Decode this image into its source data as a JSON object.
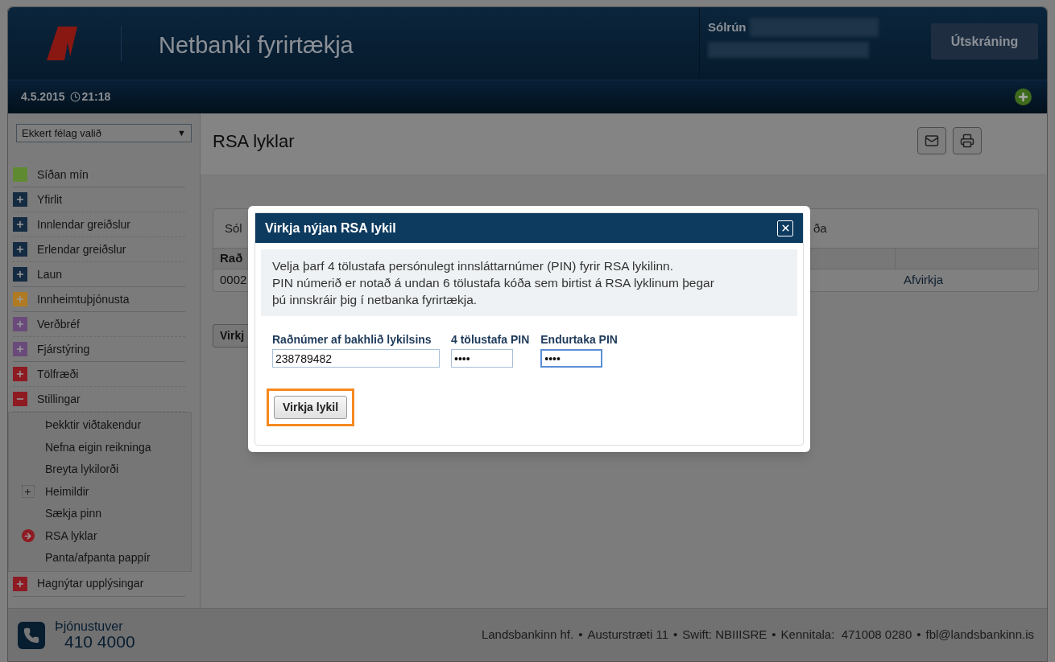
{
  "header": {
    "title": "Netbanki fyrirtækja",
    "user_name": "Sólrún",
    "logout_button": "Útskráning",
    "date": "4.5.2015",
    "time": "21:18"
  },
  "sidebar": {
    "company_select": {
      "value": "Ekkert félag valið",
      "arrow": "▼"
    },
    "items": [
      {
        "label": "Síðan mín",
        "kind": "page",
        "color": "#5f8a32"
      },
      {
        "label": "Yfirlit",
        "kind": "section",
        "color": "#142b42",
        "expanded": false
      },
      {
        "label": "Innlendar greiðslur",
        "kind": "section",
        "color": "#142b42",
        "expanded": false
      },
      {
        "label": "Erlendar greiðslur",
        "kind": "section",
        "color": "#142b42",
        "expanded": false
      },
      {
        "label": "Laun",
        "kind": "section",
        "color": "#142b42",
        "expanded": false
      },
      {
        "label": "Innheimtuþjónusta",
        "kind": "section",
        "color": "#b07a22",
        "expanded": false
      },
      {
        "label": "Verðbréf",
        "kind": "section",
        "color": "#6a4a7a",
        "expanded": false
      },
      {
        "label": "Fjárstýring",
        "kind": "section",
        "color": "#6a4a7a",
        "expanded": false
      },
      {
        "label": "Tölfræði",
        "kind": "section",
        "color": "#8e1a22",
        "expanded": false
      },
      {
        "label": "Stillingar",
        "kind": "section",
        "color": "#8e1a22",
        "expanded": true,
        "children": [
          {
            "label": "Þekktir viðtakendur",
            "kind": "link",
            "selected": false
          },
          {
            "label": "Nefna eigin reikninga",
            "kind": "link",
            "selected": false
          },
          {
            "label": "Breyta lykilorði",
            "kind": "link",
            "selected": false
          },
          {
            "label": "Heimildir",
            "kind": "group",
            "selected": false
          },
          {
            "label": "Sækja pinn",
            "kind": "link",
            "selected": false
          },
          {
            "label": "RSA lyklar",
            "kind": "link",
            "selected": true
          },
          {
            "label": "Panta/afpanta pappír",
            "kind": "link",
            "selected": false
          }
        ]
      },
      {
        "label": "Hagnýtar upplýsingar",
        "kind": "section",
        "color": "#8e1a22",
        "expanded": false
      }
    ]
  },
  "content": {
    "title": "RSA lyklar",
    "table": {
      "title_start": "Sól",
      "title_end": "ða",
      "header_start": "Rað",
      "row_start": "0002",
      "row_action": "Afvirkja"
    },
    "button_start": "Virkj"
  },
  "dialog": {
    "title": "Virkja nýjan RSA lykil",
    "info": [
      "Velja þarf 4 tölustafa persónulegt innsláttarnúmer (PIN) fyrir RSA lykilinn.",
      "PIN númerið er notað á undan 6 tölustafa kóða sem birtist á RSA lyklinum þegar",
      "þú innskráir þig í netbanka fyrirtækja."
    ],
    "fields": [
      {
        "label": "Raðnúmer af bakhlið lykilsins",
        "value": "238789482",
        "focused": false
      },
      {
        "label": "4 tölustafa PIN",
        "value": "••••",
        "focused": false
      },
      {
        "label": "Endurtaka PIN",
        "value": "••••",
        "focused": true
      }
    ],
    "submit_button": {
      "label": "Virkja lykil",
      "highlighted": true
    }
  },
  "footer": {
    "service_label": "Þjónustuver",
    "phone": "410 4000",
    "separator": "•",
    "info": [
      "Landsbankinn hf.",
      "Austurstræti 11",
      "Swift: NBIIISRE",
      "Kennitala:  471008 0280",
      "fbl@landsbankinn.is"
    ]
  }
}
